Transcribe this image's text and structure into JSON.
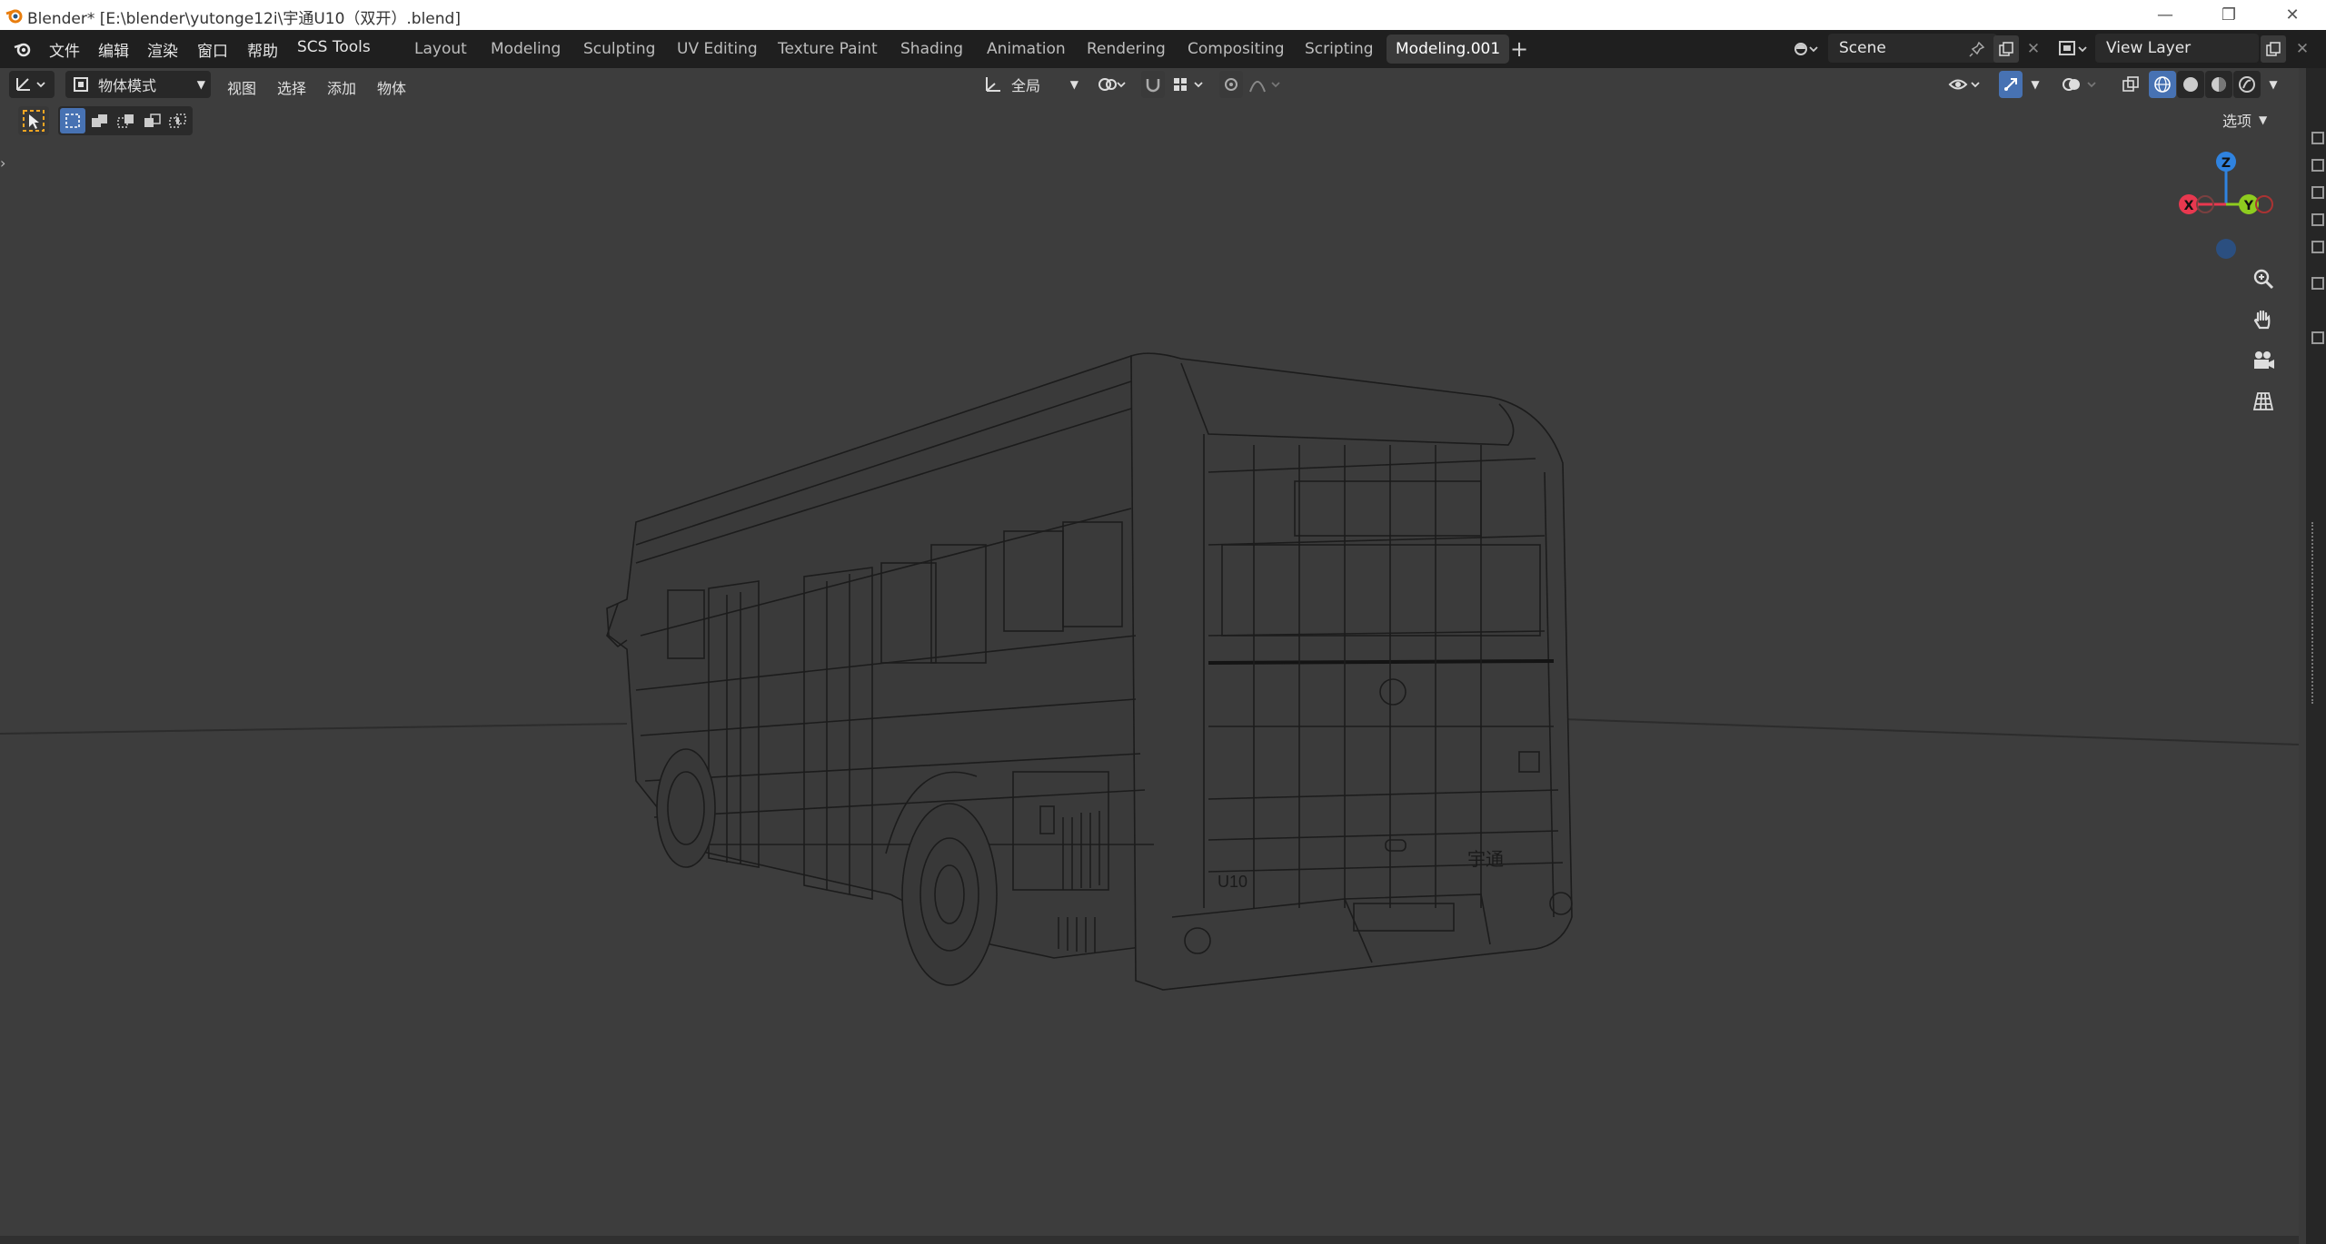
{
  "window": {
    "title": "Blender* [E:\\blender\\yutonge12i\\宇通U10（双开）.blend]",
    "controls": [
      "minimize-icon",
      "restore-icon",
      "close-icon"
    ]
  },
  "menubar": {
    "items": [
      "文件",
      "编辑",
      "渲染",
      "窗口",
      "帮助",
      "SCS Tools"
    ]
  },
  "workspaces": {
    "tabs": [
      "Layout",
      "Modeling",
      "Sculpting",
      "UV Editing",
      "Texture Paint",
      "Shading",
      "Animation",
      "Rendering",
      "Compositing",
      "Scripting",
      "Modeling.001"
    ],
    "active": "Modeling.001",
    "add_icon": "plus-icon"
  },
  "scene": {
    "label": "Scene"
  },
  "view_layer": {
    "label": "View Layer"
  },
  "viewport_header": {
    "mode": "物体模式",
    "menus": [
      "视图",
      "选择",
      "添加",
      "物体"
    ],
    "orientation": "全局",
    "options_label": "选项"
  },
  "gizmo": {
    "x": "X",
    "y": "Y",
    "z": "Z"
  },
  "vehicle_markings": {
    "model": "U10",
    "brand": "宇通"
  },
  "colors": {
    "titlebar": "#ffffff",
    "topbar": "#1f1f1f",
    "viewport": "#3d3d3d",
    "accent_blue": "#4772b3",
    "axis_x": "#e8384f",
    "axis_y": "#8ecc1f",
    "axis_z": "#2f83e0",
    "active_tool": "#f5a623"
  }
}
